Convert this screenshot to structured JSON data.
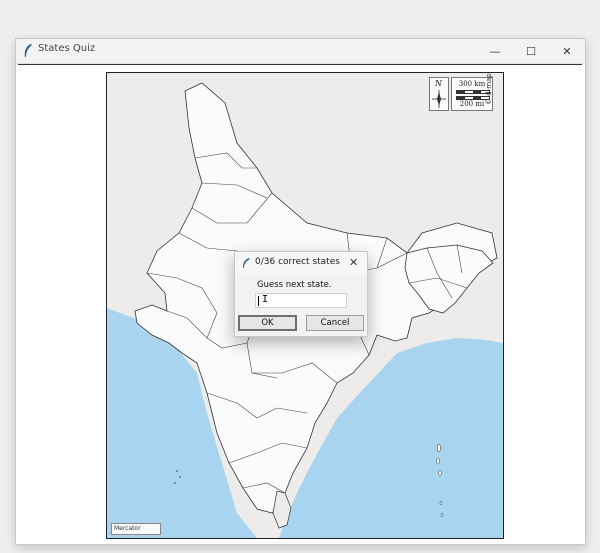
{
  "window": {
    "title": "States Quiz",
    "controls": {
      "minimize": "—",
      "maximize": "☐",
      "close": "✕"
    }
  },
  "map": {
    "compass_label": "N",
    "scale_km": "300 km",
    "scale_mi": "200 mi",
    "copyright": "© d-maps.com",
    "projection": "Mercator"
  },
  "dialog": {
    "title": "0/36 correct states",
    "prompt": "Guess next state.",
    "input_value": "",
    "ok_label": "OK",
    "cancel_label": "Cancel",
    "close_glyph": "✕"
  },
  "colors": {
    "sea": "#a8d4ef",
    "land_india": "#f9fbfd",
    "land_neighbors": "#eeecea",
    "borders": "#333333"
  }
}
